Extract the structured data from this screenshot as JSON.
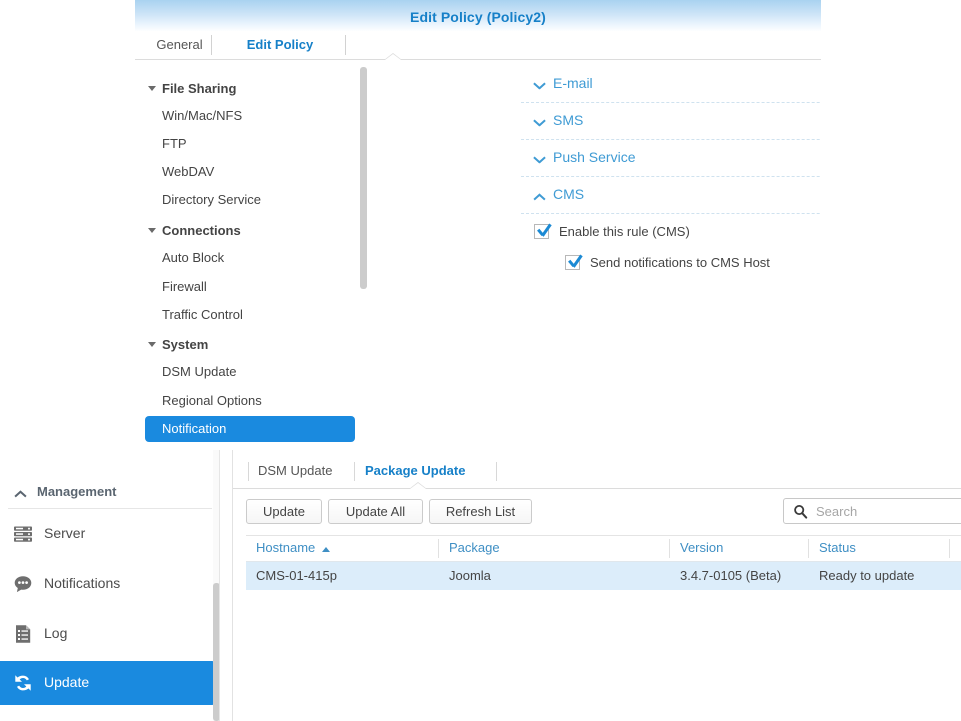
{
  "dialog": {
    "title": "Edit Policy (Policy2)",
    "tabs": [
      {
        "label": "General",
        "active": false
      },
      {
        "label": "Edit Policy",
        "active": true
      }
    ],
    "nav": [
      {
        "label": "File Sharing",
        "type": "group"
      },
      {
        "label": "Win/Mac/NFS",
        "type": "item"
      },
      {
        "label": "FTP",
        "type": "item"
      },
      {
        "label": "WebDAV",
        "type": "item"
      },
      {
        "label": "Directory Service",
        "type": "item"
      },
      {
        "label": "Connections",
        "type": "group"
      },
      {
        "label": "Auto Block",
        "type": "item"
      },
      {
        "label": "Firewall",
        "type": "item"
      },
      {
        "label": "Traffic Control",
        "type": "item"
      },
      {
        "label": "System",
        "type": "group"
      },
      {
        "label": "DSM Update",
        "type": "item"
      },
      {
        "label": "Regional Options",
        "type": "item"
      },
      {
        "label": "Notification",
        "type": "item",
        "selected": true
      }
    ],
    "sections": [
      {
        "label": "E-mail",
        "expanded": false,
        "icon": "chevron-down-icon"
      },
      {
        "label": "SMS",
        "expanded": false,
        "icon": "chevron-down-icon"
      },
      {
        "label": "Push Service",
        "expanded": false,
        "icon": "chevron-down-icon"
      },
      {
        "label": "CMS",
        "expanded": true,
        "icon": "chevron-up-icon"
      }
    ],
    "checkboxes": [
      {
        "label": "Enable this rule (CMS)",
        "checked": true
      },
      {
        "label": "Send notifications to CMS Host",
        "checked": true
      }
    ]
  },
  "sidebar": {
    "group_label": "Management",
    "group_icon": "chevron-up-icon",
    "items": [
      {
        "label": "Server",
        "icon": "server-icon",
        "active": false
      },
      {
        "label": "Notifications",
        "icon": "speech-bubble-icon",
        "active": false
      },
      {
        "label": "Log",
        "icon": "log-document-icon",
        "active": false
      },
      {
        "label": "Update",
        "icon": "refresh-icon",
        "active": true
      }
    ]
  },
  "main": {
    "tabs": [
      {
        "label": "DSM Update",
        "active": false
      },
      {
        "label": "Package Update",
        "active": true
      }
    ],
    "buttons": [
      {
        "label": "Update"
      },
      {
        "label": "Update All"
      },
      {
        "label": "Refresh List"
      }
    ],
    "search": {
      "placeholder": "Search",
      "value": "",
      "icon": "search-icon"
    },
    "table": {
      "columns": [
        {
          "label": "Hostname",
          "sorted": "asc"
        },
        {
          "label": "Package",
          "sorted": null
        },
        {
          "label": "Version",
          "sorted": null
        },
        {
          "label": "Status",
          "sorted": null
        }
      ],
      "rows": [
        {
          "hostname": "CMS-01-415p",
          "package": "Joomla",
          "version": "3.4.7-0105 (Beta)",
          "status": "Ready to update",
          "selected": true
        }
      ]
    }
  },
  "colors": {
    "accent_blue": "#1a8adf",
    "link_blue": "#1680c8",
    "section_blue": "#3f9bd4",
    "header_gradient_top": "#a9d2f0",
    "row_selected": "#dcedfa"
  }
}
